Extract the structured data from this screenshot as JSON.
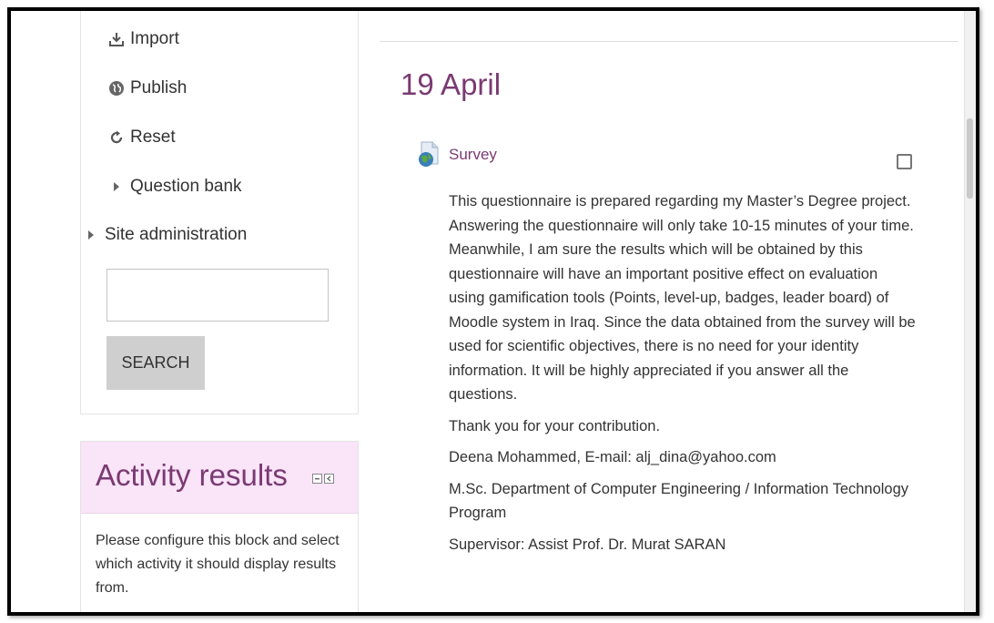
{
  "nav": {
    "items": [
      {
        "label": "Import",
        "icon": "import-icon"
      },
      {
        "label": "Publish",
        "icon": "globe-icon"
      },
      {
        "label": "Reset",
        "icon": "reset-icon"
      },
      {
        "label": "Question bank",
        "icon": "expand-arrow-icon"
      },
      {
        "label": "Site administration",
        "icon": "expand-arrow-icon"
      }
    ],
    "search": {
      "value": "",
      "button_label": "SEARCH"
    }
  },
  "activity_results": {
    "title": "Activity results",
    "body": "Please configure this block and select which activity it should display results from."
  },
  "main": {
    "date_heading": "19 April",
    "activity": {
      "name": "Survey",
      "icon": "survey-icon",
      "paragraphs": [
        "This questionnaire is prepared regarding my Master’s Degree project. Answering the questionnaire will only take 10-15 minutes of your time. Meanwhile, I am sure the results which will be obtained by this questionnaire will have an important positive effect on evaluation using gamification tools (Points, level-up, badges, leader board) of Moodle system in Iraq. Since the data obtained from the survey will be used for scientific objectives, there is no need for your identity information. It will be highly appreciated if you answer all the questions.",
        "Thank you for your contribution.",
        "Deena Mohammed, E-mail: alj_dina@yahoo.com",
        "M.Sc. Department of Computer Engineering / Information Technology Program",
        "Supervisor: Assist Prof. Dr. Murat SARAN"
      ]
    }
  },
  "colors": {
    "accent": "#7a3a73",
    "block_header_bg": "#f9e4f8",
    "button_bg": "#cfcfcf"
  }
}
